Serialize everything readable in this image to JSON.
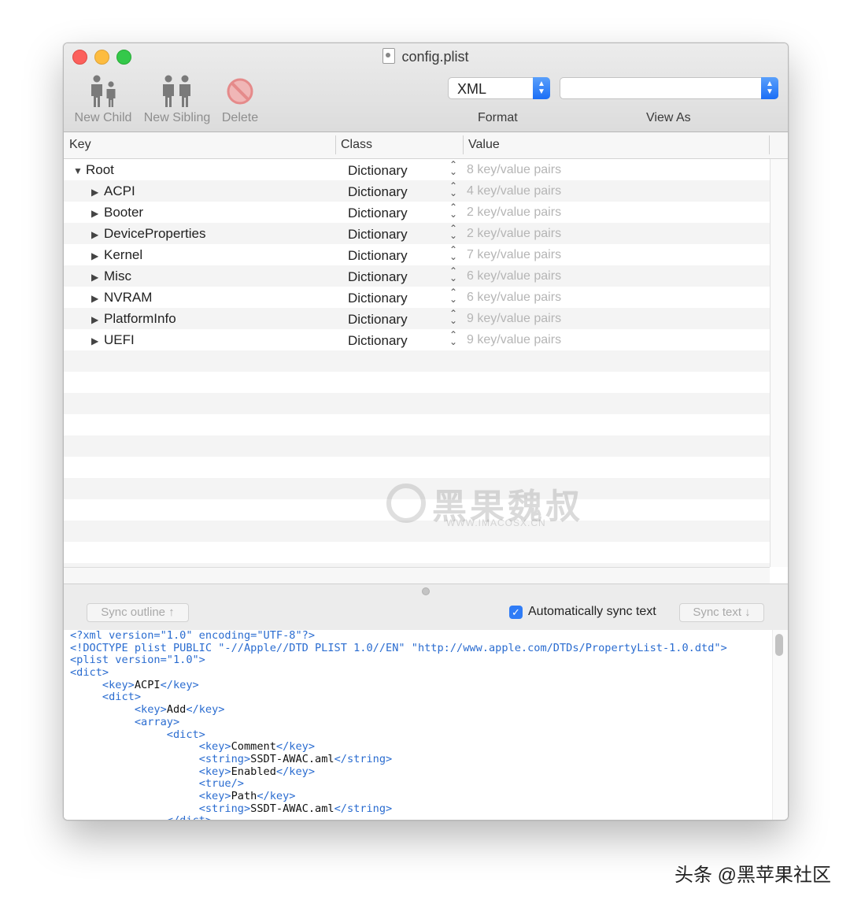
{
  "window": {
    "title": "config.plist"
  },
  "toolbar": {
    "new_child": "New Child",
    "new_sibling": "New Sibling",
    "delete": "Delete",
    "format_value": "XML",
    "format_label": "Format",
    "view_as_value": "",
    "view_as_label": "View As"
  },
  "outline": {
    "columns": {
      "key": "Key",
      "class": "Class",
      "value": "Value"
    },
    "rows": [
      {
        "key": "Root",
        "expanded": true,
        "class": "Dictionary",
        "value": "8 key/value pairs"
      },
      {
        "key": "ACPI",
        "class": "Dictionary",
        "value": "4 key/value pairs"
      },
      {
        "key": "Booter",
        "class": "Dictionary",
        "value": "2 key/value pairs"
      },
      {
        "key": "DeviceProperties",
        "class": "Dictionary",
        "value": "2 key/value pairs"
      },
      {
        "key": "Kernel",
        "class": "Dictionary",
        "value": "7 key/value pairs"
      },
      {
        "key": "Misc",
        "class": "Dictionary",
        "value": "6 key/value pairs"
      },
      {
        "key": "NVRAM",
        "class": "Dictionary",
        "value": "6 key/value pairs"
      },
      {
        "key": "PlatformInfo",
        "class": "Dictionary",
        "value": "9 key/value pairs"
      },
      {
        "key": "UEFI",
        "class": "Dictionary",
        "value": "9 key/value pairs"
      }
    ]
  },
  "sync": {
    "sync_outline": "Sync outline ↑",
    "auto_sync_label": "Automatically sync text",
    "auto_sync_checked": true,
    "sync_text": "Sync text ↓"
  },
  "xml_lines": [
    "<?xml version=\"1.0\" encoding=\"UTF-8\"?>",
    "<!DOCTYPE plist PUBLIC \"-//Apple//DTD PLIST 1.0//EN\" \"http://www.apple.com/DTDs/PropertyList-1.0.dtd\">",
    "<plist version=\"1.0\">",
    "<dict>",
    "\t<key>ACPI</key>",
    "\t<dict>",
    "\t\t<key>Add</key>",
    "\t\t<array>",
    "\t\t\t<dict>",
    "\t\t\t\t<key>Comment</key>",
    "\t\t\t\t<string>SSDT-AWAC.aml</string>",
    "\t\t\t\t<key>Enabled</key>",
    "\t\t\t\t<true/>",
    "\t\t\t\t<key>Path</key>",
    "\t\t\t\t<string>SSDT-AWAC.aml</string>",
    "\t\t\t</dict>"
  ],
  "watermark": {
    "main": "黑果魏叔",
    "sub": "WWW.IMACOSX.CN"
  },
  "credit": "头条 @黑苹果社区",
  "colors": {
    "accent": "#2f7cf6",
    "xml_tag": "#2a6cd0",
    "value_text": "#b5b5b5"
  }
}
